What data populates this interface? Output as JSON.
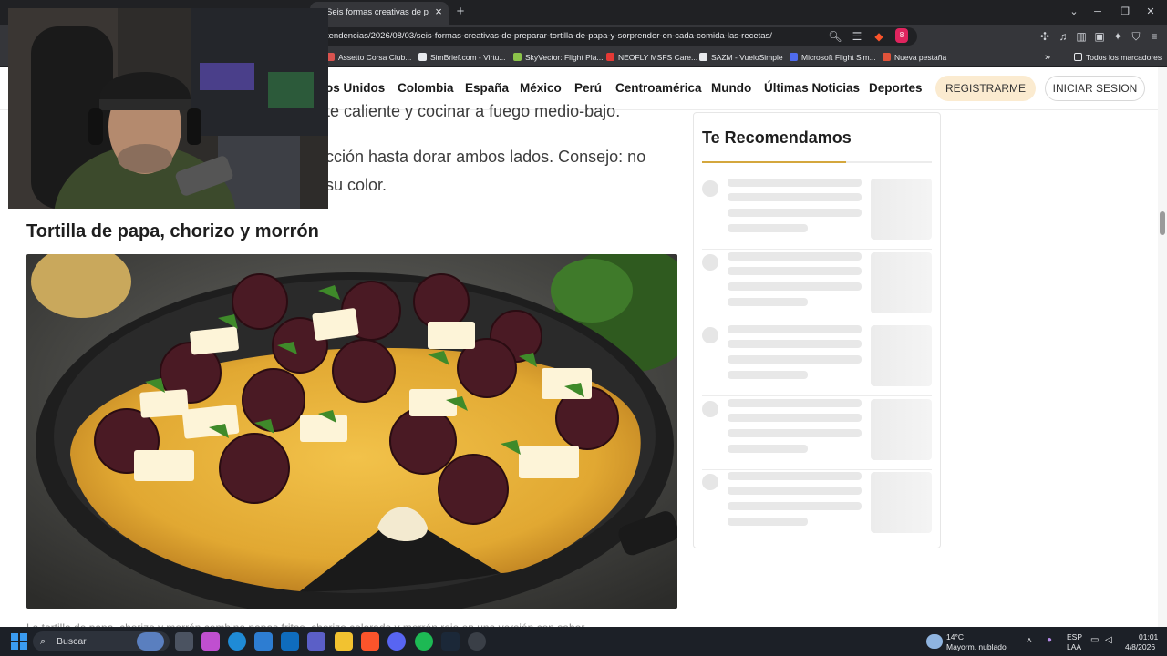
{
  "browser": {
    "tab_title": "Seis formas creativas de preparar",
    "tab_close": "×",
    "new_tab": "+",
    "url": "tendencias/2026/08/03/seis-formas-creativas-de-preparar-tortilla-de-papa-y-sorprender-en-cada-comida-las-recetas/",
    "shield_count": "8",
    "window_controls": {
      "dropdown": "⌄",
      "minimize": "─",
      "restore": "❐",
      "close": "✕"
    },
    "bookmarks": [
      {
        "label": "Assetto Corsa Club...",
        "color": "#d9534f"
      },
      {
        "label": "SimBrief.com - Virtu...",
        "color": "#e8eaed"
      },
      {
        "label": "SkyVector: Flight Pla...",
        "color": "#8bc34a"
      },
      {
        "label": "NEOFLY MSFS Care...",
        "color": "#e53935"
      },
      {
        "label": "SAZM - VueloSimple",
        "color": "#e8eaed"
      },
      {
        "label": "Microsoft Flight Sim...",
        "color": "#4f6bed"
      },
      {
        "label": "Nueva pestaña",
        "color": "#e0533a"
      }
    ],
    "bookmarks_more": "»",
    "all_bookmarks": "Todos los marcadores"
  },
  "site": {
    "nav": [
      "os Unidos",
      "Colombia",
      "España",
      "México",
      "Perú",
      "Centroamérica",
      "Mundo",
      "Últimas Noticias",
      "Deportes"
    ],
    "register": "REGISTRARME",
    "login": "INICIAR SESION"
  },
  "article": {
    "lines": [
      "te caliente y cocinar a fuego medio-bajo.",
      "cción hasta dorar ambos lados. Consejo: no",
      "su color."
    ],
    "heading": "Tortilla de papa, chorizo y morrón",
    "caption": "La tortilla de papa, chorizo y morrón combina papas fritas, chorizo colorado y morrón rojo en una versión con sabor"
  },
  "sidebar": {
    "title": "Te Recomendamos",
    "placeholder_rows": 5
  },
  "taskbar": {
    "search": "Buscar",
    "weather_temp": "14°C",
    "weather_desc": "Mayorm. nublado",
    "lang_top": "ESP",
    "lang_bottom": "LAA",
    "time": "01:01",
    "date": "4/8/2026"
  }
}
